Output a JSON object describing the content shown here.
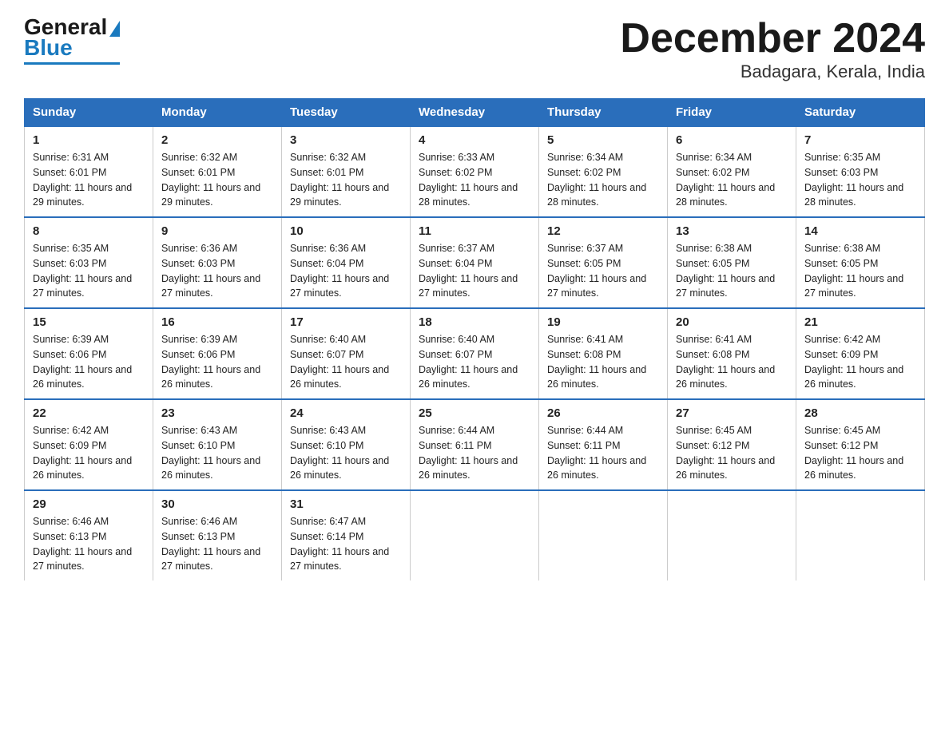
{
  "header": {
    "logo_main": "General",
    "logo_sub": "Blue",
    "title": "December 2024",
    "subtitle": "Badagara, Kerala, India"
  },
  "columns": [
    "Sunday",
    "Monday",
    "Tuesday",
    "Wednesday",
    "Thursday",
    "Friday",
    "Saturday"
  ],
  "weeks": [
    [
      {
        "day": "1",
        "sunrise": "6:31 AM",
        "sunset": "6:01 PM",
        "daylight": "11 hours and 29 minutes."
      },
      {
        "day": "2",
        "sunrise": "6:32 AM",
        "sunset": "6:01 PM",
        "daylight": "11 hours and 29 minutes."
      },
      {
        "day": "3",
        "sunrise": "6:32 AM",
        "sunset": "6:01 PM",
        "daylight": "11 hours and 29 minutes."
      },
      {
        "day": "4",
        "sunrise": "6:33 AM",
        "sunset": "6:02 PM",
        "daylight": "11 hours and 28 minutes."
      },
      {
        "day": "5",
        "sunrise": "6:34 AM",
        "sunset": "6:02 PM",
        "daylight": "11 hours and 28 minutes."
      },
      {
        "day": "6",
        "sunrise": "6:34 AM",
        "sunset": "6:02 PM",
        "daylight": "11 hours and 28 minutes."
      },
      {
        "day": "7",
        "sunrise": "6:35 AM",
        "sunset": "6:03 PM",
        "daylight": "11 hours and 28 minutes."
      }
    ],
    [
      {
        "day": "8",
        "sunrise": "6:35 AM",
        "sunset": "6:03 PM",
        "daylight": "11 hours and 27 minutes."
      },
      {
        "day": "9",
        "sunrise": "6:36 AM",
        "sunset": "6:03 PM",
        "daylight": "11 hours and 27 minutes."
      },
      {
        "day": "10",
        "sunrise": "6:36 AM",
        "sunset": "6:04 PM",
        "daylight": "11 hours and 27 minutes."
      },
      {
        "day": "11",
        "sunrise": "6:37 AM",
        "sunset": "6:04 PM",
        "daylight": "11 hours and 27 minutes."
      },
      {
        "day": "12",
        "sunrise": "6:37 AM",
        "sunset": "6:05 PM",
        "daylight": "11 hours and 27 minutes."
      },
      {
        "day": "13",
        "sunrise": "6:38 AM",
        "sunset": "6:05 PM",
        "daylight": "11 hours and 27 minutes."
      },
      {
        "day": "14",
        "sunrise": "6:38 AM",
        "sunset": "6:05 PM",
        "daylight": "11 hours and 27 minutes."
      }
    ],
    [
      {
        "day": "15",
        "sunrise": "6:39 AM",
        "sunset": "6:06 PM",
        "daylight": "11 hours and 26 minutes."
      },
      {
        "day": "16",
        "sunrise": "6:39 AM",
        "sunset": "6:06 PM",
        "daylight": "11 hours and 26 minutes."
      },
      {
        "day": "17",
        "sunrise": "6:40 AM",
        "sunset": "6:07 PM",
        "daylight": "11 hours and 26 minutes."
      },
      {
        "day": "18",
        "sunrise": "6:40 AM",
        "sunset": "6:07 PM",
        "daylight": "11 hours and 26 minutes."
      },
      {
        "day": "19",
        "sunrise": "6:41 AM",
        "sunset": "6:08 PM",
        "daylight": "11 hours and 26 minutes."
      },
      {
        "day": "20",
        "sunrise": "6:41 AM",
        "sunset": "6:08 PM",
        "daylight": "11 hours and 26 minutes."
      },
      {
        "day": "21",
        "sunrise": "6:42 AM",
        "sunset": "6:09 PM",
        "daylight": "11 hours and 26 minutes."
      }
    ],
    [
      {
        "day": "22",
        "sunrise": "6:42 AM",
        "sunset": "6:09 PM",
        "daylight": "11 hours and 26 minutes."
      },
      {
        "day": "23",
        "sunrise": "6:43 AM",
        "sunset": "6:10 PM",
        "daylight": "11 hours and 26 minutes."
      },
      {
        "day": "24",
        "sunrise": "6:43 AM",
        "sunset": "6:10 PM",
        "daylight": "11 hours and 26 minutes."
      },
      {
        "day": "25",
        "sunrise": "6:44 AM",
        "sunset": "6:11 PM",
        "daylight": "11 hours and 26 minutes."
      },
      {
        "day": "26",
        "sunrise": "6:44 AM",
        "sunset": "6:11 PM",
        "daylight": "11 hours and 26 minutes."
      },
      {
        "day": "27",
        "sunrise": "6:45 AM",
        "sunset": "6:12 PM",
        "daylight": "11 hours and 26 minutes."
      },
      {
        "day": "28",
        "sunrise": "6:45 AM",
        "sunset": "6:12 PM",
        "daylight": "11 hours and 26 minutes."
      }
    ],
    [
      {
        "day": "29",
        "sunrise": "6:46 AM",
        "sunset": "6:13 PM",
        "daylight": "11 hours and 27 minutes."
      },
      {
        "day": "30",
        "sunrise": "6:46 AM",
        "sunset": "6:13 PM",
        "daylight": "11 hours and 27 minutes."
      },
      {
        "day": "31",
        "sunrise": "6:47 AM",
        "sunset": "6:14 PM",
        "daylight": "11 hours and 27 minutes."
      },
      null,
      null,
      null,
      null
    ]
  ]
}
